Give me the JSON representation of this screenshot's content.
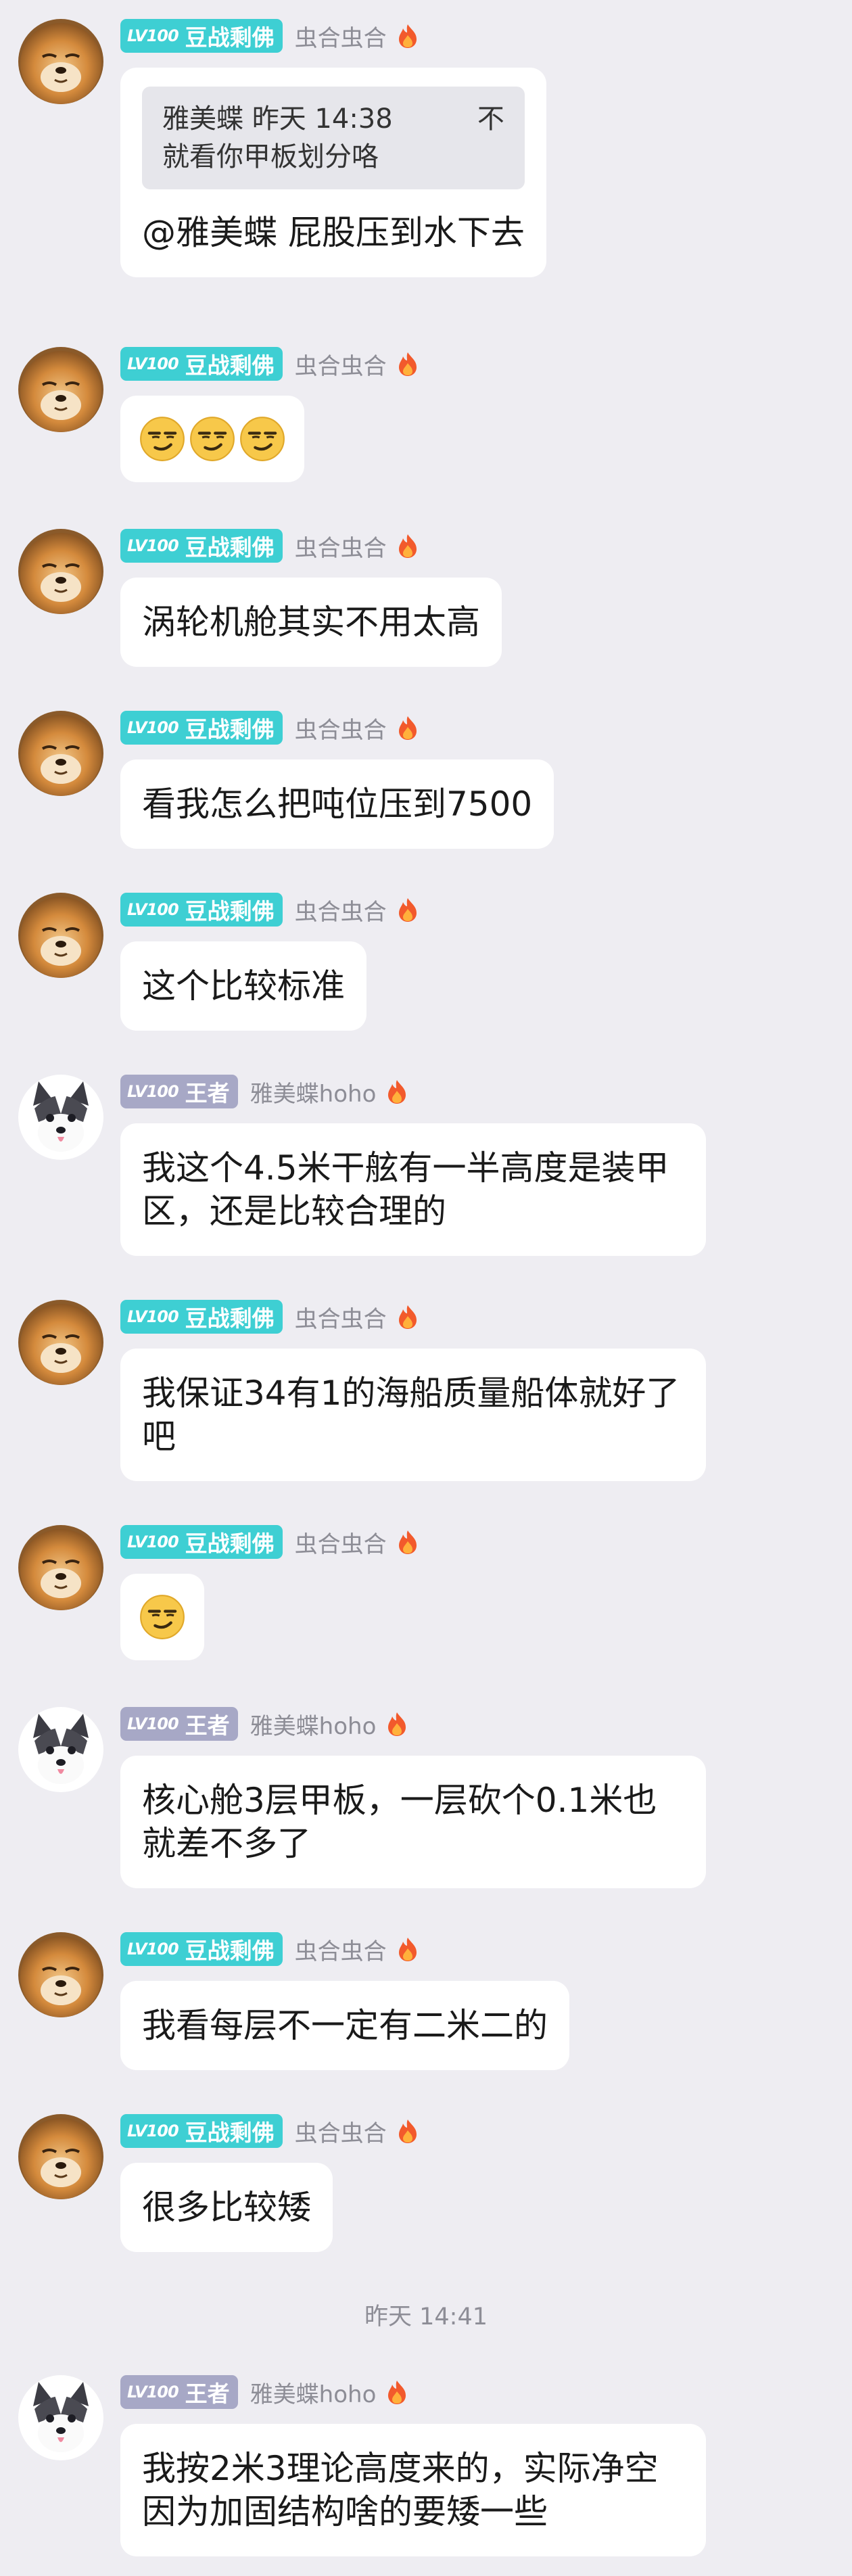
{
  "users": {
    "doudou": {
      "level": "LV100",
      "title": "豆战剩佛",
      "nickname": "虫合虫合"
    },
    "wangzhe": {
      "level": "LV100",
      "title": "王者",
      "nickname": "雅美蝶hoho"
    }
  },
  "messages": [
    {
      "quote": {
        "author": "雅美蝶",
        "time": "昨天 14:38",
        "action": "不",
        "text": "就看你甲板划分咯"
      },
      "text": "@雅美蝶 屁股压到水下去"
    },
    {
      "emoji": "smirk-emoji-x3"
    },
    {
      "text": "涡轮机舱其实不用太高"
    },
    {
      "text": "看我怎么把吨位压到7500"
    },
    {
      "text": "这个比较标准"
    },
    {
      "text": "我这个4.5米干舷有一半高度是装甲区，还是比较合理的"
    },
    {
      "text": "我保证34有1的海船质量船体就好了吧"
    },
    {
      "emoji": "smirk-emoji"
    },
    {
      "text": "核心舱3层甲板，一层砍个0.1米也就差不多了"
    },
    {
      "text": "我看每层不一定有二米二的"
    },
    {
      "text": "很多比较矮"
    },
    {
      "text": "我按2米3理论高度来的，实际净空因为加固结构啥的要矮一些"
    }
  ],
  "timestamp": "昨天 14:41",
  "colors": {
    "background": "#eeedf2",
    "badge_teal": "#3ecfd3",
    "badge_gray": "#a7a8c6",
    "bubble": "#ffffff"
  }
}
